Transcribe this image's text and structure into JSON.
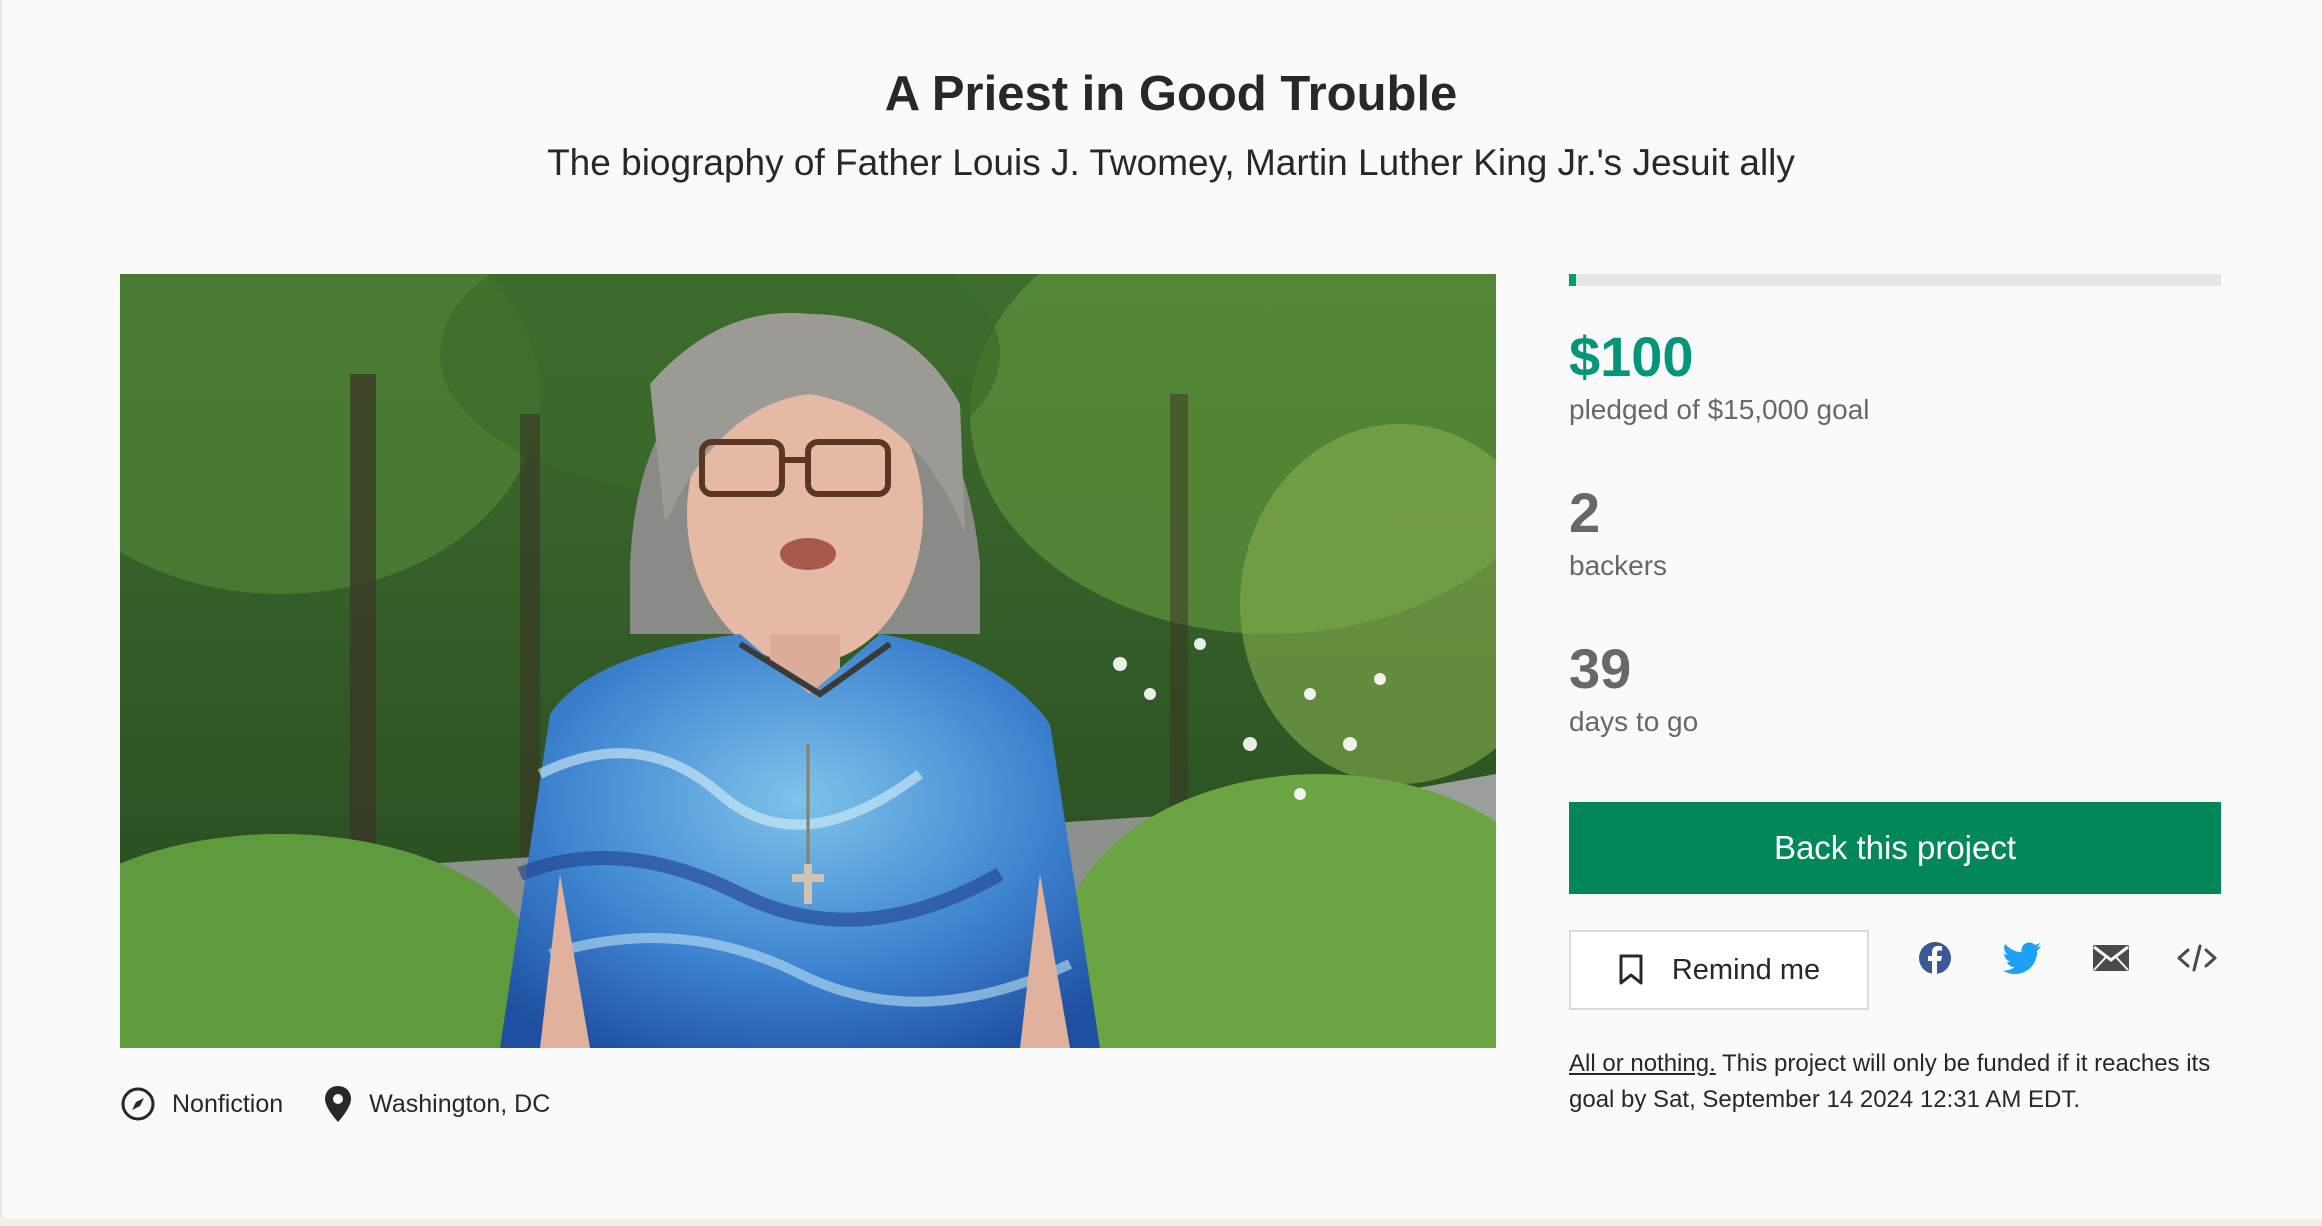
{
  "project": {
    "title": "A Priest in Good Trouble",
    "subtitle": "The biography of Father Louis J. Twomey, Martin Luther King Jr.'s Jesuit ally"
  },
  "media": {
    "type": "video-preview"
  },
  "meta": {
    "category": "Nonfiction",
    "location": "Washington, DC"
  },
  "stats": {
    "pledged": "$100",
    "pledged_label": "pledged of $15,000 goal",
    "funded_fraction": 0.0067,
    "backers": "2",
    "backers_label": "backers",
    "days": "39",
    "days_label": "days to go"
  },
  "actions": {
    "back_label": "Back this project",
    "remind_label": "Remind me"
  },
  "share": {
    "icons": [
      "facebook-icon",
      "twitter-icon",
      "email-icon",
      "embed-icon"
    ]
  },
  "funding_note": {
    "link_text": "All or nothing.",
    "text": " This project will only be funded if it reaches its goal by Sat, September 14 2024 12:31 AM EDT."
  },
  "colors": {
    "accent": "#05967a",
    "button": "#028858",
    "facebook": "#3b5998",
    "twitter": "#1da1f2"
  }
}
